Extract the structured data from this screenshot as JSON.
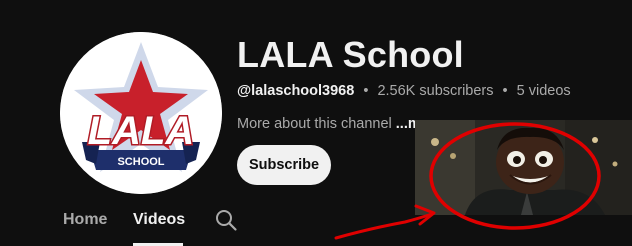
{
  "channel": {
    "name": "LALA School",
    "handle": "@lalaschool3968",
    "subscribers": "2.56K subscribers",
    "videos": "5 videos",
    "separator": "•",
    "about": "More about this channel",
    "more_label": "...more",
    "subscribe_label": "Subscribe"
  },
  "logo": {
    "main_text": "LALA",
    "sub_text": "SCHOOL",
    "colors": {
      "star": "#c8202b",
      "banner": "#1e2f6b",
      "text_fill": "#ffffff",
      "text_stroke": "#b01c26"
    }
  },
  "tabs": [
    {
      "label": "Home",
      "active": false
    },
    {
      "label": "Videos",
      "active": true
    }
  ],
  "icons": {
    "search": "search-icon"
  },
  "annotation": {
    "color": "#e00000",
    "shape": "ellipse-with-arrow"
  },
  "theme": {
    "background": "#0f0f0f",
    "text": "#f1f1f1",
    "secondary": "#aaaaaa"
  }
}
